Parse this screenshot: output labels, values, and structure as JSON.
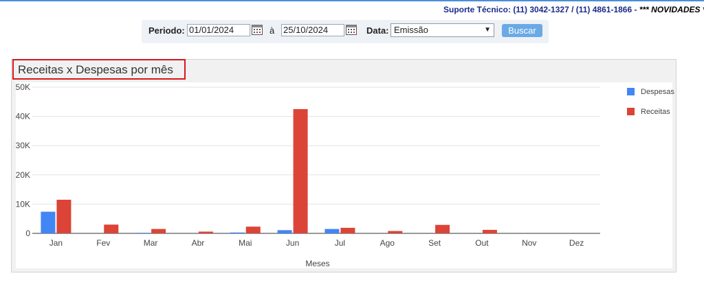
{
  "support": {
    "text": "Suporte Técnico: (11) 3042-1327 / (11) 4861-1866 - ",
    "novidades": "*** NOVIDADES ***"
  },
  "filter": {
    "periodo_label": "Periodo:",
    "date_from": "01/01/2024",
    "separator": "à",
    "date_to": "25/10/2024",
    "data_label": "Data:",
    "data_selected": "Emissão",
    "search_button": "Buscar"
  },
  "colors": {
    "despesas": "#4285f4",
    "receitas": "#db4437",
    "accent": "#6aa9e6",
    "highlight": "#d7161b"
  },
  "chart_data": {
    "type": "bar",
    "title": "Receitas x Despesas por mês",
    "xlabel": "Meses",
    "ylabel": "",
    "categories": [
      "Jan",
      "Fev",
      "Mar",
      "Abr",
      "Mai",
      "Jun",
      "Jul",
      "Ago",
      "Set",
      "Out",
      "Nov",
      "Dez"
    ],
    "series": [
      {
        "name": "Despesas",
        "values": [
          7400,
          0,
          200,
          0,
          300,
          1100,
          1500,
          0,
          0,
          0,
          0,
          0
        ]
      },
      {
        "name": "Receitas",
        "values": [
          11500,
          3000,
          1500,
          600,
          2300,
          42500,
          1900,
          800,
          2900,
          1200,
          0,
          0
        ]
      }
    ],
    "ylim": [
      0,
      50000
    ],
    "yticks": [
      "0",
      "10K",
      "20K",
      "30K",
      "40K",
      "50K"
    ],
    "grid": true,
    "legend": "right"
  }
}
